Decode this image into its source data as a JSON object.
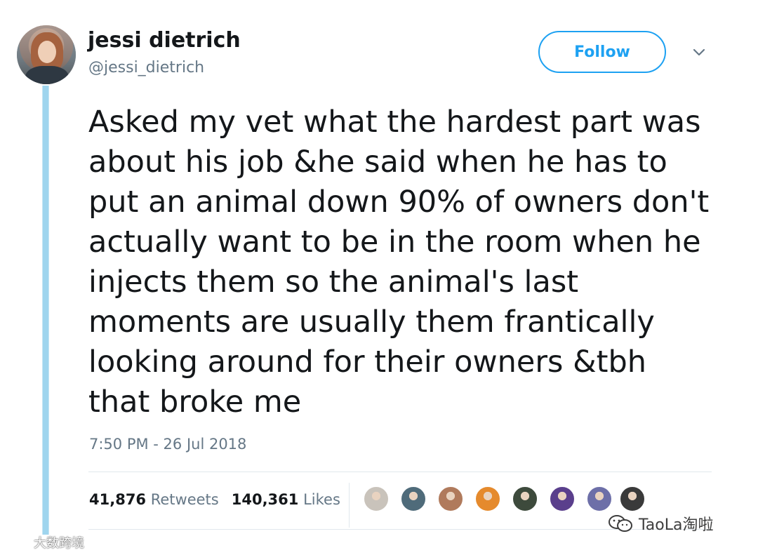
{
  "author": {
    "name": "jessi dietrich",
    "handle": "@jessi_dietrich"
  },
  "follow_label": "Follow",
  "tweet": {
    "lines": [
      "Asked my vet what the hardest part was",
      "about his job &he said when he has to",
      "put an animal down 90% of owners don't",
      "actually want to be in the room when he",
      "injects them so the animal's last",
      "moments are usually them frantically",
      "looking around for their owners &tbh",
      "that broke me"
    ],
    "timestamp": "7:50 PM - 26 Jul 2018"
  },
  "stats": {
    "retweets_count": "41,876",
    "retweets_label": "Retweets",
    "likes_count": "140,361",
    "likes_label": "Likes"
  },
  "likers": [
    {
      "name": "liker-1",
      "color": "#c9c3bb"
    },
    {
      "name": "liker-2",
      "color": "#4f6b7a"
    },
    {
      "name": "liker-3",
      "color": "#b07a5c"
    },
    {
      "name": "liker-4",
      "color": "#e58a2d"
    },
    {
      "name": "liker-5",
      "color": "#3d4a3c"
    },
    {
      "name": "liker-6",
      "color": "#5a3f8c"
    },
    {
      "name": "liker-7",
      "color": "#6d6fa8"
    },
    {
      "name": "liker-8",
      "color": "#3a3a3a"
    }
  ],
  "watermarks": {
    "left_text": "大数跨境",
    "right_text": "TaoLa淘啦"
  },
  "icons": {
    "chevron": "chevron-down-icon",
    "wechat": "wechat-icon"
  },
  "colors": {
    "accent": "#1da1f2",
    "muted": "#657786",
    "thread_line": "#9fd5ee"
  }
}
